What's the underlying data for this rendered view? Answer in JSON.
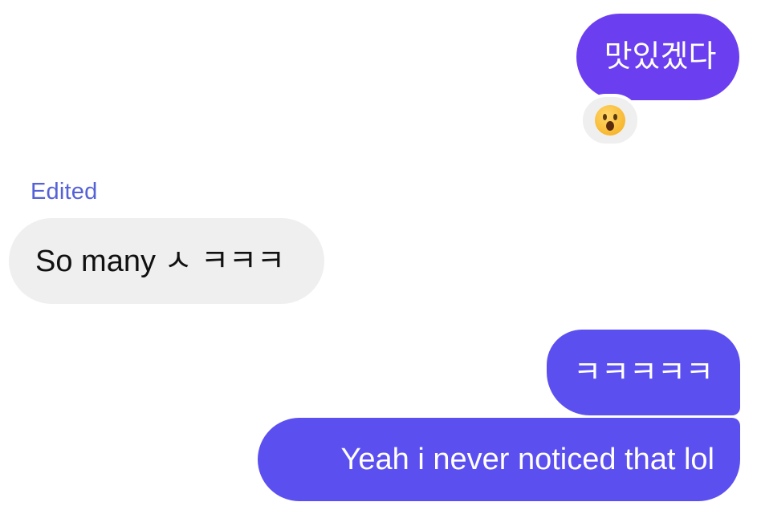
{
  "conversation": {
    "messages": [
      {
        "direction": "sent",
        "text": "맛있겠다",
        "reaction": "astonished-face-emoji"
      },
      {
        "direction": "received",
        "edited_label": "Edited",
        "text": "So many ㅅ ㅋㅋㅋ"
      },
      {
        "direction": "sent",
        "text": "ㅋㅋㅋㅋㅋ"
      },
      {
        "direction": "sent",
        "text": "Yeah i never noticed that lol"
      }
    ]
  },
  "colors": {
    "sent_bubble_primary": "#6b3ef0",
    "sent_bubble_secondary": "#5b4ff0",
    "received_bubble": "#efefef",
    "edited_label": "#5561d6"
  }
}
